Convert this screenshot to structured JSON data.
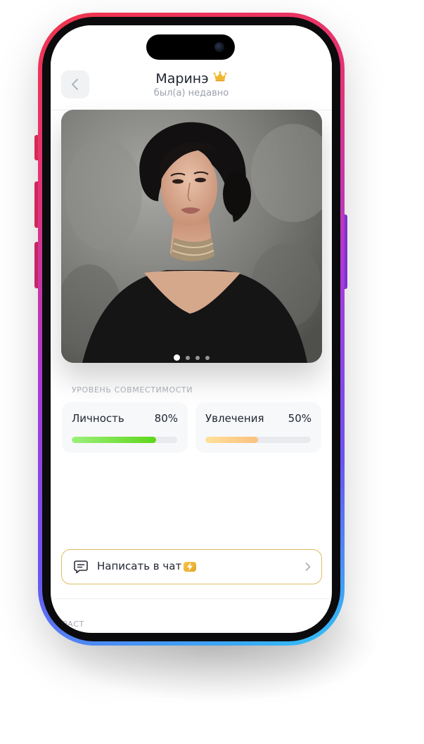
{
  "profile": {
    "name": "Маринэ",
    "status": "был(а) недавно",
    "photo_count": 4,
    "active_photo": 1
  },
  "compatibility": {
    "section_label": "УРОВЕНЬ СОВМЕСТИМОСТИ",
    "items": [
      {
        "label": "Личность",
        "value_text": "80%",
        "percent": 80,
        "color": "#5ed61b"
      },
      {
        "label": "Увлечения",
        "value_text": "50%",
        "percent": 50,
        "color": "#fcc07f"
      }
    ]
  },
  "chat": {
    "label": "Написать в чат"
  },
  "sections": {
    "age_label": "ОЗРАСТ"
  },
  "icons": {
    "back": "chevron-left-icon",
    "premium": "crown-icon",
    "chat": "chat-bubble-icon",
    "boost": "lightning-icon",
    "forward": "chevron-right-icon"
  },
  "colors": {
    "accent_gold": "#e0bd63",
    "frame_gradient": [
      "#f0354d",
      "#a93ad8",
      "#2ec2f5"
    ]
  }
}
